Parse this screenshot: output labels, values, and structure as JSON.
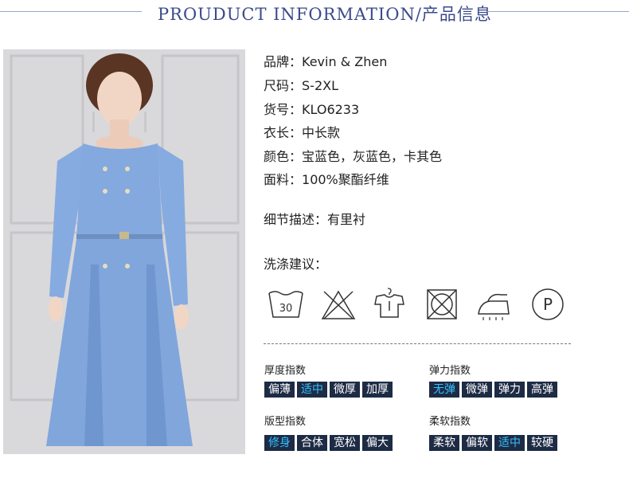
{
  "header": {
    "title": "PROUDUCT INFORMATION/产品信息"
  },
  "specs": [
    {
      "label": "品牌：",
      "value": "Kevin & Zhen"
    },
    {
      "label": "尺码：",
      "value": "S-2XL"
    },
    {
      "label": "货号：",
      "value": "KLO6233"
    },
    {
      "label": "衣长：",
      "value": "中长款"
    },
    {
      "label": "颜色：",
      "value": "宝蓝色，灰蓝色，卡其色"
    },
    {
      "label": "面料：",
      "value": "100%聚酯纤维"
    }
  ],
  "detail": {
    "label": "细节描述：",
    "value": "有里衬"
  },
  "care": {
    "title": "洗涤建议：",
    "wash_temp": "30",
    "dryclean_letter": "P",
    "icons": [
      "wash-30-icon",
      "no-bleach-icon",
      "hang-dry-icon",
      "no-tumble-dry-icon",
      "iron-icon",
      "dry-clean-p-icon"
    ]
  },
  "indices": {
    "thickness": {
      "title": "厚度指数",
      "options": [
        "偏薄",
        "适中",
        "微厚",
        "加厚"
      ],
      "selected": 1
    },
    "elasticity": {
      "title": "弹力指数",
      "options": [
        "无弹",
        "微弹",
        "弹力",
        "高弹"
      ],
      "selected": 0
    },
    "fit": {
      "title": "版型指数",
      "options": [
        "修身",
        "合体",
        "宽松",
        "偏大"
      ],
      "selected": 0
    },
    "softness": {
      "title": "柔软指数",
      "options": [
        "柔软",
        "偏软",
        "适中",
        "较硬"
      ],
      "selected": 2
    }
  },
  "colors": {
    "selected": "#33c0ff",
    "cell_bg": "#1d2b45",
    "header": "#3b4a8a",
    "dress": "#7fa6dc"
  }
}
